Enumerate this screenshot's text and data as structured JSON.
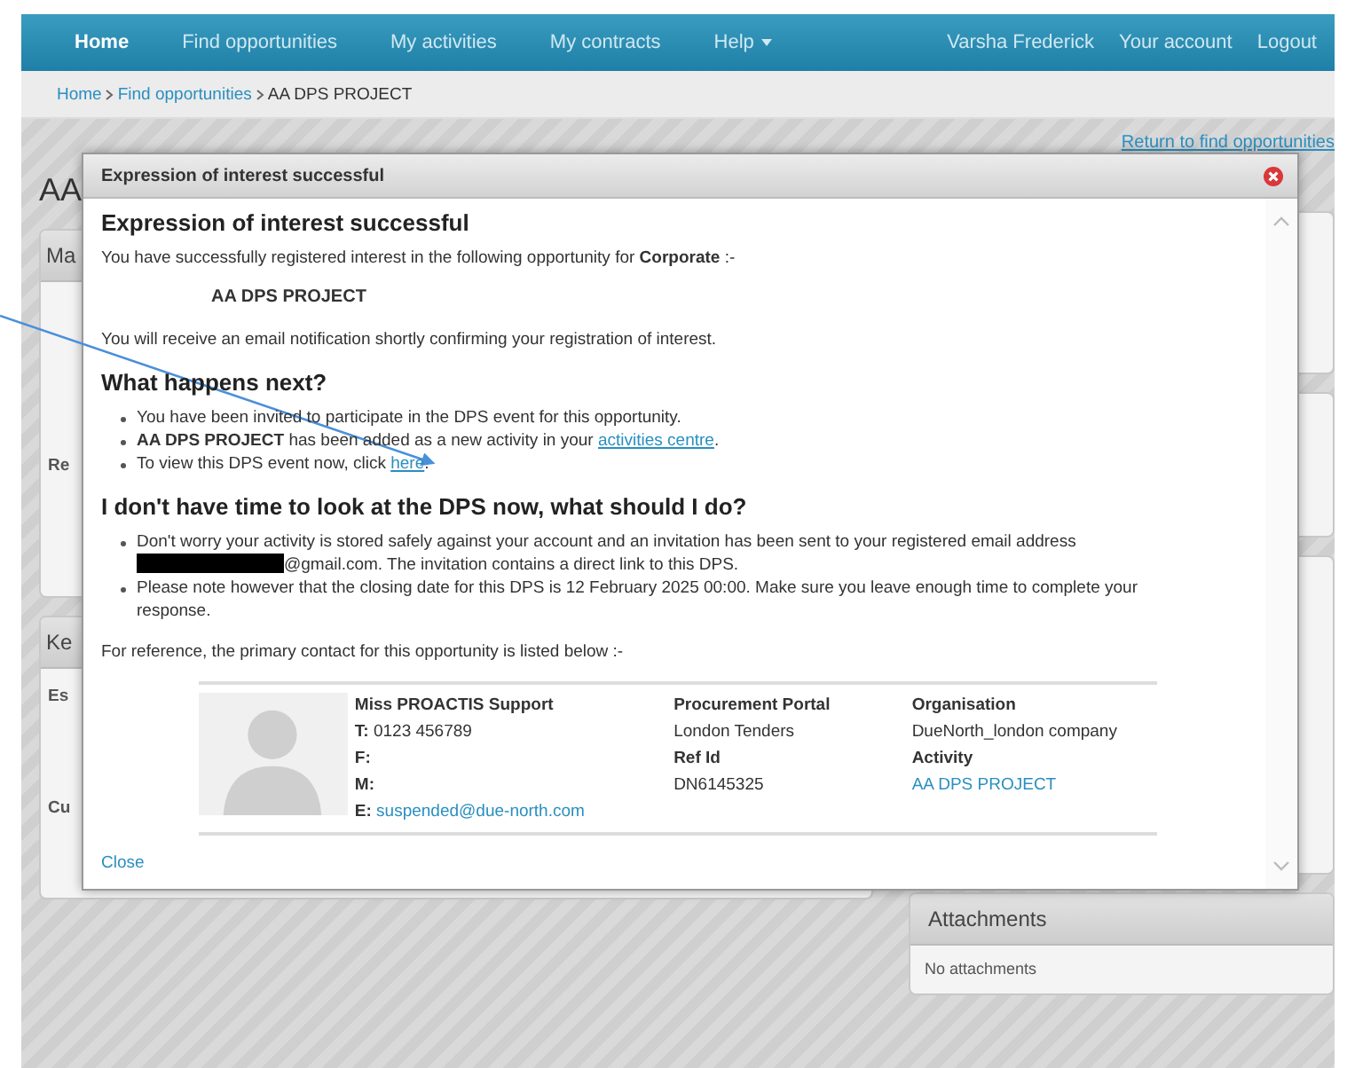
{
  "nav": {
    "items": [
      {
        "label": "Home",
        "selected": true,
        "has_menu": false
      },
      {
        "label": "Find opportunities",
        "selected": false,
        "has_menu": false
      },
      {
        "label": "My activities",
        "selected": false,
        "has_menu": false
      },
      {
        "label": "My contracts",
        "selected": false,
        "has_menu": false
      },
      {
        "label": "Help",
        "selected": false,
        "has_menu": true
      }
    ],
    "user": "Varsha Frederick",
    "account": "Your account",
    "logout": "Logout"
  },
  "breadcrumb": [
    "Home",
    "Find opportunities",
    "AA DPS PROJECT"
  ],
  "return_link": "Return to find opportunities",
  "page_title": "AA",
  "left_panels": [
    {
      "title": "Ma",
      "labels": [
        "Re"
      ]
    },
    {
      "title": "Ke",
      "labels": [
        "Es",
        "Cu"
      ]
    }
  ],
  "attachments": {
    "title": "Attachments",
    "empty": "No attachments"
  },
  "dialog": {
    "title": "Expression of interest successful",
    "heading": "Expression of interest successful",
    "intro": "You have successfully registered interest in the following opportunity for **Corporate** :-",
    "project": "AA DPS PROJECT",
    "notice": "You will receive an email notification shortly confirming your registration of interest.",
    "next_heading": "What happens next?",
    "next_items": [
      {
        "text": "You have been invited to participate in the DPS event for this opportunity."
      },
      {
        "text": "**AA DPS PROJECT** has been added as a new activity in your ",
        "link": "activities centre",
        "after": "."
      },
      {
        "text": "To view this DPS event now, click ",
        "link": "here",
        "after": "."
      }
    ],
    "later_heading": "I don't have time to look at the DPS now, what should I do?",
    "later_items": [
      {
        "text": "Don't worry your activity is stored safely against your account and an invitation has been sent to your registered email address",
        "redacted": true,
        "continuation": "@gmail.com. The invitation contains a direct link to this DPS."
      },
      {
        "text": "Please note however that the closing date for this DPS is 12 February 2025 00:00. Make sure you leave enough time to complete your response.",
        "redacted": false
      }
    ],
    "reference": "For reference, the primary contact for this opportunity is listed below :-",
    "contact": {
      "name": "Miss PROACTIS Support",
      "fields": [
        {
          "label": "T:",
          "value": "0123 456789",
          "kind": "text"
        },
        {
          "label": "F:"
        },
        {
          "label": "M:"
        },
        {
          "label": "E:",
          "value": "suspended@due-north.com",
          "kind": "link"
        }
      ],
      "columns": [
        [
          {
            "label": "Procurement Portal",
            "value": "London Tenders",
            "kind": "text"
          },
          {
            "label": "Ref Id",
            "value": "DN6145325",
            "kind": "text"
          }
        ],
        [
          {
            "label": "Organisation",
            "value": "DueNorth_london company",
            "kind": "text"
          },
          {
            "label": "Activity",
            "value": "AA DPS PROJECT",
            "kind": "link"
          }
        ]
      ]
    },
    "close": "Close"
  }
}
